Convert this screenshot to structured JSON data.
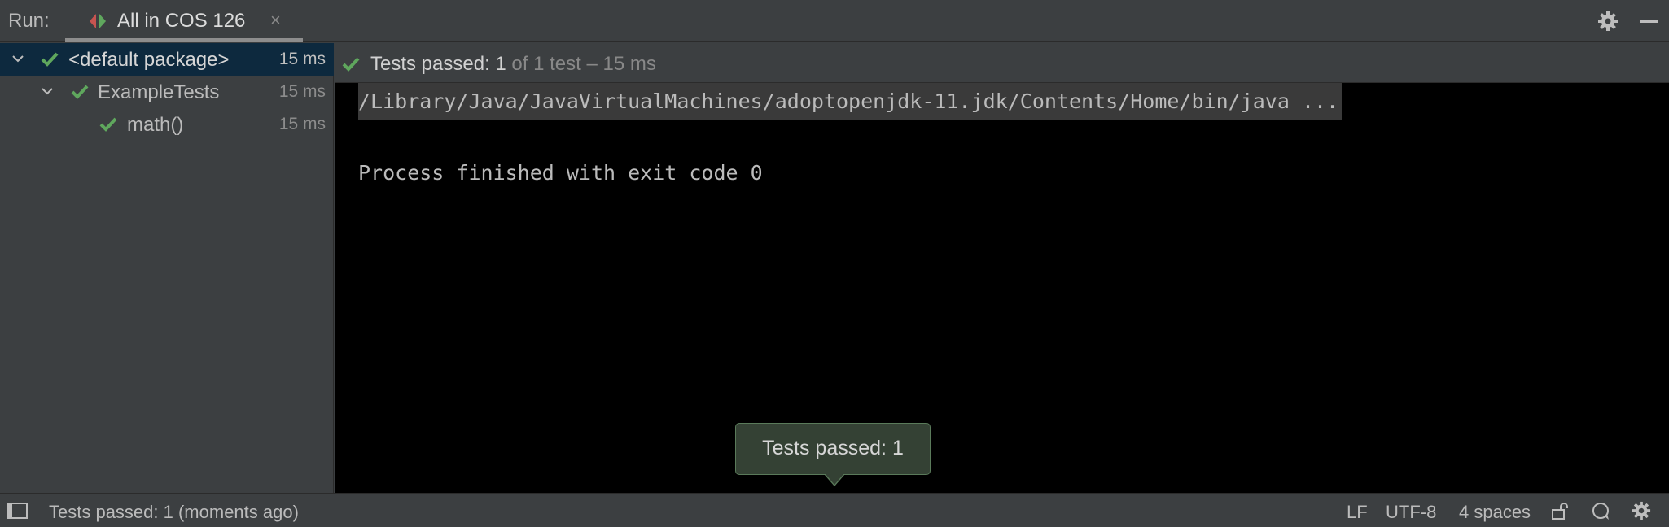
{
  "run_bar": {
    "label": "Run:",
    "tab": {
      "label": "All in COS 126",
      "close": "×"
    },
    "icons": [
      "run-config-icon",
      "gear-icon",
      "minimize-icon"
    ]
  },
  "tree": {
    "rows": [
      {
        "label": "<default package>",
        "time": "15 ms",
        "status": "passed",
        "selected": true
      },
      {
        "label": "ExampleTests",
        "time": "15 ms",
        "status": "passed",
        "selected": false
      },
      {
        "label": "math()",
        "time": "15 ms",
        "status": "passed",
        "selected": false
      }
    ]
  },
  "console_header": {
    "main": "Tests passed: 1",
    "sub": " of 1 test – 15 ms"
  },
  "console": {
    "command": "/Library/Java/JavaVirtualMachines/adoptopenjdk-11.jdk/Contents/Home/bin/java ...",
    "exit": "Process finished with exit code 0"
  },
  "balloon": {
    "text": "Tests passed: 1"
  },
  "status_bar": {
    "message": "Tests passed: 1 (moments ago)",
    "line_ending": "LF",
    "encoding": "UTF-8",
    "indent": "4 spaces"
  },
  "colors": {
    "check_green": "#5fa75d",
    "selection": "#0d293e",
    "console_bg": "#000000",
    "panel_bg": "#3c3f41"
  }
}
